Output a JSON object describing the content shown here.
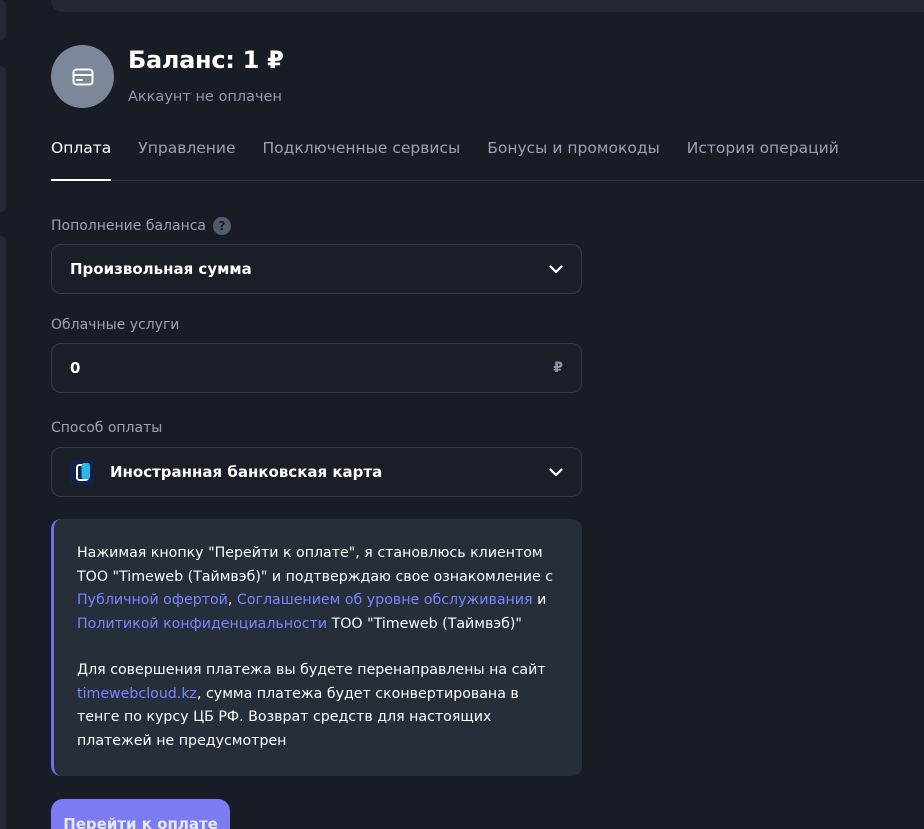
{
  "header": {
    "balance_title": "Баланс: 1 ₽",
    "account_status": "Аккаунт не оплачен",
    "avatar_icon": "card-icon"
  },
  "tabs": [
    {
      "label": "Оплата",
      "active": true
    },
    {
      "label": "Управление",
      "active": false
    },
    {
      "label": "Подключенные сервисы",
      "active": false
    },
    {
      "label": "Бонусы и промокоды",
      "active": false
    },
    {
      "label": "История операций",
      "active": false
    }
  ],
  "form": {
    "topup_label": "Пополнение баланса",
    "topup_help": "?",
    "topup_selected": "Произвольная сумма",
    "cloud_label": "Облачные услуги",
    "cloud_value": "0",
    "cloud_currency": "₽",
    "method_label": "Способ оплаты",
    "method_selected": "Иностранная банковская карта"
  },
  "notice": {
    "p1_part1": "Нажимая кнопку \"Перейти к оплате\", я становлюсь клиентом ТОО \"Timeweb (Таймвэб)\" и подтверждаю свое ознакомление с",
    "link_offer": "Публичной офертой",
    "comma": ",",
    "link_sla": "Соглашением об уровне обслуживания",
    "and": "и",
    "link_privacy": "Политикой конфиденциальности",
    "p1_part2": "ТОО \"Timeweb (Таймвэб)\"",
    "p2_part1": "Для совершения платежа вы будете перенаправлены на сайт",
    "link_site": "timewebcloud.kz",
    "p2_part2": ", сумма платежа будет сконвертирована в тенге по курсу ЦБ РФ. Возврат средств для настоящих платежей не предусмотрен"
  },
  "pay_button": "Перейти к оплате",
  "colors": {
    "background": "#181d25",
    "accent": "#7b7bf2",
    "link": "#7a86ff",
    "panel": "#262e3a"
  }
}
